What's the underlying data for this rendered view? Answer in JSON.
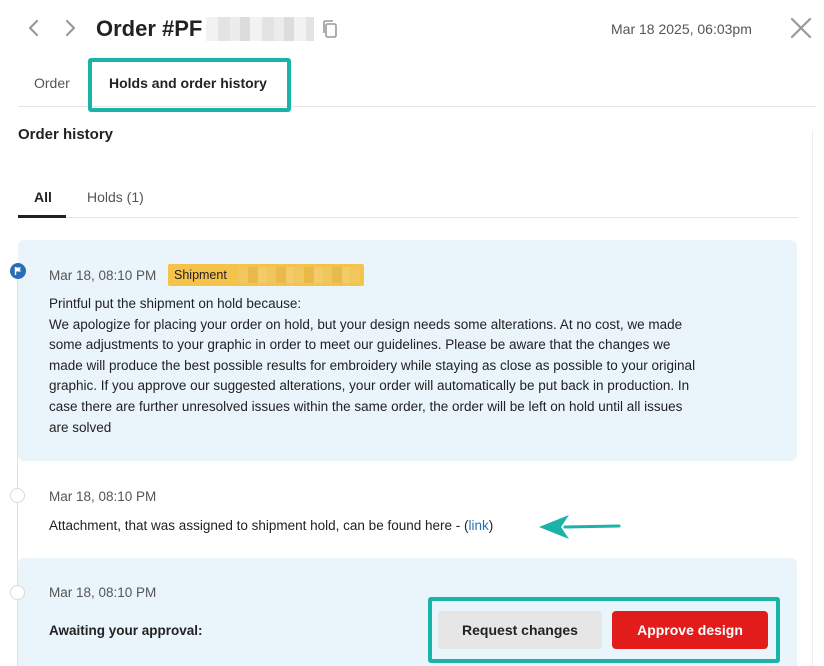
{
  "header": {
    "title": "Order #PF",
    "date": "Mar 18 2025, 06:03pm"
  },
  "main_tabs": [
    {
      "label": "Order",
      "active": false
    },
    {
      "label": "Holds and order history",
      "active": true
    }
  ],
  "section_title": "Order history",
  "sub_tabs": [
    {
      "label": "All",
      "active": true
    },
    {
      "label": "Holds (1)",
      "active": false
    }
  ],
  "history": [
    {
      "timestamp": "Mar 18, 08:10 PM",
      "badge": "Shipment",
      "message_lines": [
        "Printful put the shipment on hold because:",
        "We apologize for placing your order on hold, but your design needs some alterations. At no cost, we made",
        "some adjustments to your graphic in order to meet our guidelines. Please be aware that the changes we",
        "made will produce the best possible results for embroidery while staying as close as possible to your original",
        "graphic. If you approve our suggested alterations, your order will automatically be put back in production. In",
        "case there are further unresolved issues within the same order, the order will be left on hold until all issues",
        "are solved"
      ]
    },
    {
      "timestamp": "Mar 18, 08:10 PM",
      "text_before_link": "Attachment, that was assigned to shipment hold, can be found here - (",
      "link_label": "link",
      "text_after_link": ")"
    },
    {
      "timestamp": "Mar 18, 08:10 PM",
      "awaiting_label": "Awaiting your approval:",
      "request_button": "Request changes",
      "approve_button": "Approve design"
    }
  ],
  "colors": {
    "highlight": "#19b3a8",
    "badge": "#f5c24a",
    "card_bg": "#eaf4fb",
    "link": "#2a6fb5",
    "approve": "#e21b1b",
    "request": "#e6e6e6"
  },
  "icons": [
    "chevron-left-icon",
    "chevron-right-icon",
    "copy-icon",
    "close-icon",
    "flag-icon",
    "arrow-left-icon"
  ]
}
